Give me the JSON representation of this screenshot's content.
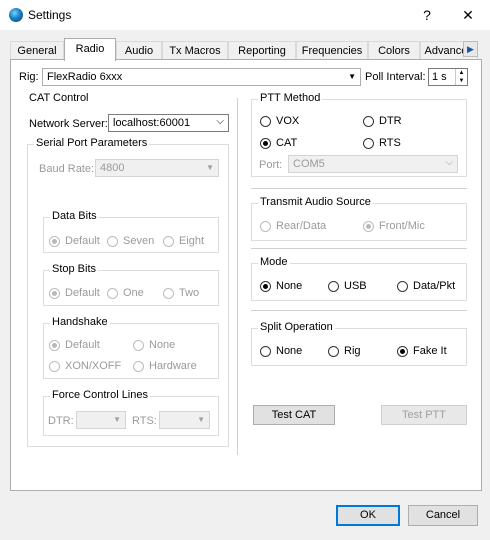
{
  "window": {
    "title": "Settings",
    "help_label": "?",
    "close_label": "✕"
  },
  "tabs": [
    "General",
    "Radio",
    "Audio",
    "Tx Macros",
    "Reporting",
    "Frequencies",
    "Colors",
    "Advanced"
  ],
  "tab_scroll": "▶",
  "rig": {
    "label": "Rig:",
    "value": "FlexRadio 6xxx",
    "poll_label": "Poll Interval:",
    "poll_value": "1 s"
  },
  "cat": {
    "title": "CAT Control",
    "network_label": "Network Server:",
    "network_value": "localhost:60001",
    "serial": {
      "title": "Serial Port Parameters",
      "baud_label": "Baud Rate:",
      "baud_value": "4800",
      "data_bits": {
        "title": "Data Bits",
        "options": [
          "Default",
          "Seven",
          "Eight"
        ],
        "selected": 0
      },
      "stop_bits": {
        "title": "Stop Bits",
        "options": [
          "Default",
          "One",
          "Two"
        ],
        "selected": 0
      },
      "handshake": {
        "title": "Handshake",
        "options": [
          "Default",
          "None",
          "XON/XOFF",
          "Hardware"
        ],
        "selected": 0
      },
      "force": {
        "title": "Force Control Lines",
        "dtr_label": "DTR:",
        "rts_label": "RTS:"
      }
    }
  },
  "ptt": {
    "title": "PTT Method",
    "options": [
      "VOX",
      "DTR",
      "CAT",
      "RTS"
    ],
    "selected": 2,
    "port_label": "Port:",
    "port_value": "COM5"
  },
  "tx_audio": {
    "title": "Transmit Audio Source",
    "options": [
      "Rear/Data",
      "Front/Mic"
    ],
    "selected": 1
  },
  "mode": {
    "title": "Mode",
    "options": [
      "None",
      "USB",
      "Data/Pkt"
    ],
    "selected": 0
  },
  "split": {
    "title": "Split Operation",
    "options": [
      "None",
      "Rig",
      "Fake It"
    ],
    "selected": 2
  },
  "buttons": {
    "test_cat": "Test CAT",
    "test_ptt": "Test PTT",
    "ok": "OK",
    "cancel": "Cancel"
  }
}
